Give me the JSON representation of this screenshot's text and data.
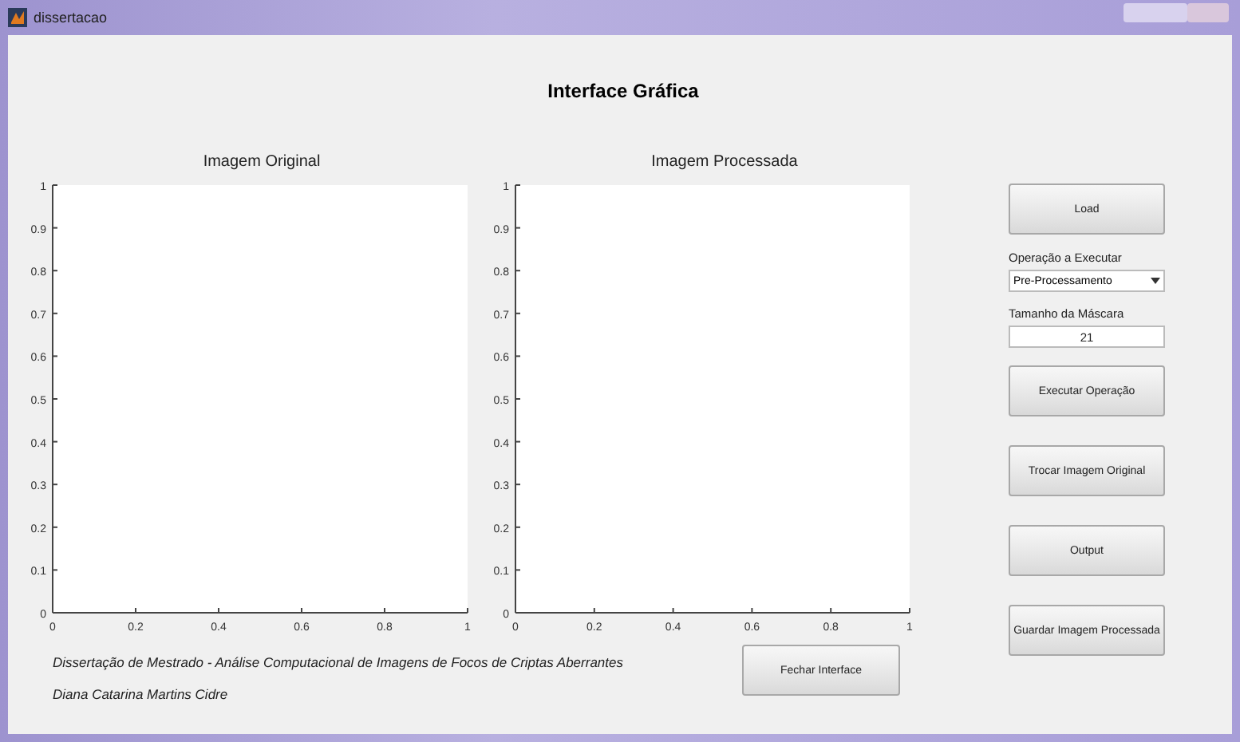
{
  "window": {
    "title": "dissertacao"
  },
  "heading": "Interface Gráfica",
  "charts": [
    {
      "chart_data": {
        "type": "line",
        "title": "Imagem Original",
        "xlim": [
          0,
          1
        ],
        "ylim": [
          0,
          1
        ],
        "xticks": [
          0,
          0.2,
          0.4,
          0.6,
          0.8,
          1
        ],
        "yticks": [
          0,
          0.1,
          0.2,
          0.3,
          0.4,
          0.5,
          0.6,
          0.7,
          0.8,
          0.9,
          1
        ]
      }
    },
    {
      "chart_data": {
        "type": "line",
        "title": "Imagem Processada",
        "xlim": [
          0,
          1
        ],
        "ylim": [
          0,
          1
        ],
        "xticks": [
          0,
          0.2,
          0.4,
          0.6,
          0.8,
          1
        ],
        "yticks": [
          0,
          0.1,
          0.2,
          0.3,
          0.4,
          0.5,
          0.6,
          0.7,
          0.8,
          0.9,
          1
        ]
      }
    }
  ],
  "controls": [
    {
      "kind": "button",
      "label": "Load"
    },
    {
      "kind": "dropdown",
      "label": "Operação a Executar",
      "value": "Pre-Processamento"
    },
    {
      "kind": "field",
      "label": "Tamanho da Máscara",
      "value": "21"
    },
    {
      "kind": "button",
      "label": "Executar Operação"
    },
    {
      "kind": "button",
      "label": "Trocar Imagem Original"
    },
    {
      "kind": "button",
      "label": "Output"
    },
    {
      "kind": "button",
      "label": "Guardar Imagem Processada"
    }
  ],
  "footer": {
    "lines": [
      "Dissertação de Mestrado - Análise Computacional de Imagens de Focos de Criptas Aberrantes",
      "Diana Catarina Martins Cidre"
    ],
    "button": "Fechar Interface"
  }
}
